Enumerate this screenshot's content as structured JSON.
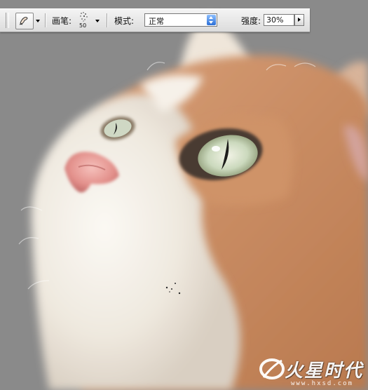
{
  "options_bar": {
    "brush_label": "画笔:",
    "brush_size": "50",
    "mode_label": "模式:",
    "mode_value": "正常",
    "strength_label": "强度:",
    "strength_value": "30%"
  },
  "icons": {
    "tool_preset": "smudge-finger-icon",
    "mode_spinner": "up-down-arrows-icon",
    "strength_slider": "right-triangle-icon"
  },
  "colors": {
    "background_gray": "#8a8a8a",
    "fur_white": "#f5f1ea",
    "fur_ginger": "#c9906a",
    "nose_pink": "#e8948f",
    "eye_iris": "#d9e4c9"
  },
  "watermark": {
    "text": "火星时代",
    "url": "www.hxsd.com"
  }
}
